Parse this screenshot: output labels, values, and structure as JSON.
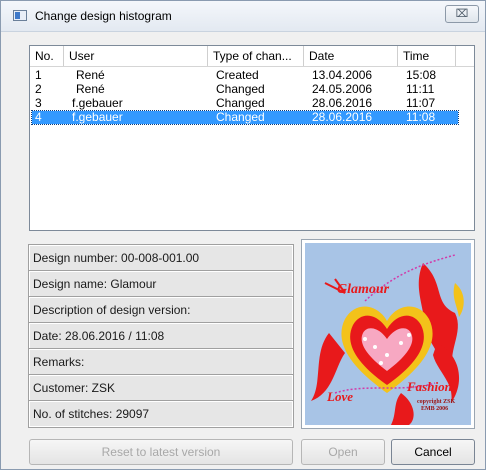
{
  "window": {
    "title": "Change design histogram",
    "close_glyph": "⌧"
  },
  "list": {
    "columns": [
      "No.",
      "User",
      "Type of chan...",
      "Date",
      "Time"
    ],
    "rows": [
      {
        "no": "1",
        "user": "René",
        "type": "Created",
        "date": "13.04.2006",
        "time": "15:08"
      },
      {
        "no": "2",
        "user": "René",
        "type": "Changed",
        "date": "24.05.2006",
        "time": "11:11"
      },
      {
        "no": "3",
        "user": "f.gebauer",
        "type": "Changed",
        "date": "28.06.2016",
        "time": "11:07"
      },
      {
        "no": "4",
        "user": "f.gebauer",
        "type": "Changed",
        "date": "28.06.2016",
        "time": "11:08"
      }
    ],
    "selected_row": 4
  },
  "details": {
    "design_number": "Design number: 00-008-001.00",
    "design_name": "Design name: Glamour",
    "description": "Description of design version:",
    "date": "Date: 28.06.2016 / 11:08",
    "remarks": "Remarks:",
    "customer": "Customer: ZSK",
    "stitches": "No. of stitches: 29097"
  },
  "preview": {
    "text_glamour": "Glamour",
    "text_love": "Love",
    "text_fashion": "Fashion",
    "copyright_line1": "copyright ZSK",
    "copyright_line2": "EMB 2006",
    "colors": {
      "bg": "#a8c4e6",
      "red": "#e8191b",
      "gold": "#f3c21a",
      "magenta": "#d23aa8"
    }
  },
  "buttons": {
    "reset": "Reset to latest version",
    "open": "Open",
    "cancel": "Cancel"
  },
  "colors": {
    "selection": "#3399ff"
  }
}
